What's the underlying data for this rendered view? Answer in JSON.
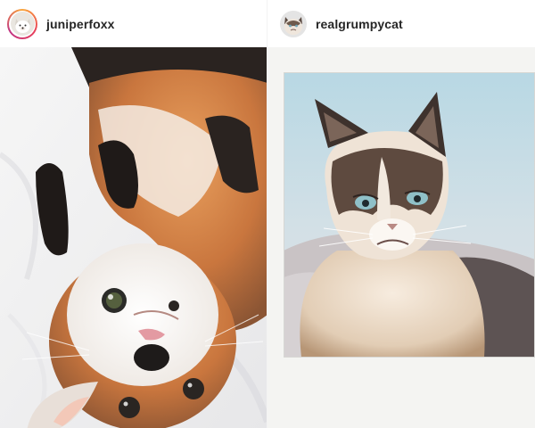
{
  "posts": [
    {
      "username": "juniperfoxx",
      "avatar_icon": "fox-avatar-icon",
      "story_ring_colors": [
        "#f9a63a",
        "#e8405b",
        "#c13584"
      ],
      "photo_subject": "fox-photo"
    },
    {
      "username": "realgrumpycat",
      "avatar_icon": "grumpy-cat-avatar-icon",
      "photo_subject": "cat-photo"
    }
  ]
}
